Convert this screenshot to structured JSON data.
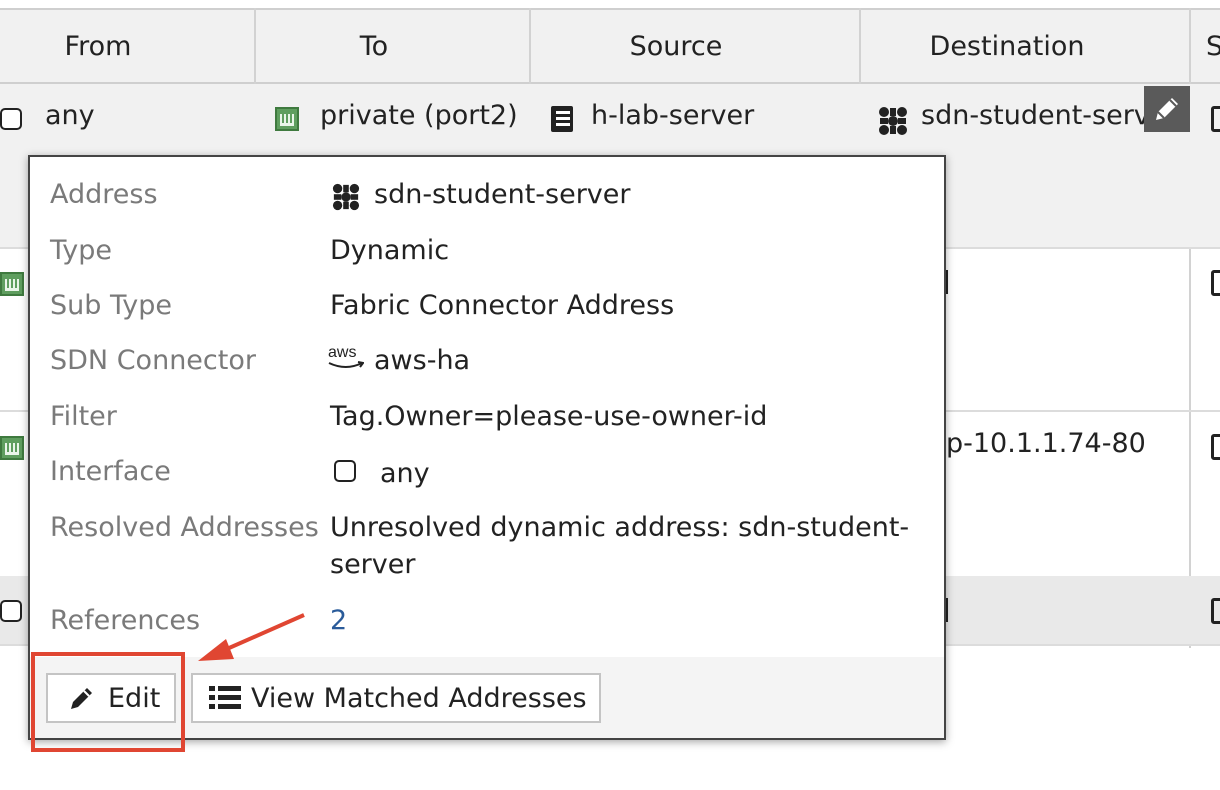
{
  "table": {
    "headers": [
      "From",
      "To",
      "Source",
      "Destination",
      "S"
    ],
    "row1": {
      "from": "any",
      "to": "private (port2)",
      "source": "h-lab-server",
      "destination": "sdn-student-serv"
    },
    "row3_destination": "p-10.1.1.74-80"
  },
  "popup": {
    "rows": [
      {
        "label": "Address",
        "value": "sdn-student-server",
        "icon": "fabric-address-icon"
      },
      {
        "label": "Type",
        "value": "Dynamic"
      },
      {
        "label": "Sub Type",
        "value": "Fabric Connector Address"
      },
      {
        "label": "SDN Connector",
        "value": "aws-ha",
        "icon": "aws-icon",
        "icon_text": "aws"
      },
      {
        "label": "Filter",
        "value": "Tag.Owner=please-use-owner-id"
      },
      {
        "label": "Interface",
        "value": "any",
        "icon": "interface-any-icon"
      },
      {
        "label": "Resolved Addresses",
        "value_line1": "Unresolved dynamic address: sdn-student-",
        "value_line2": "server"
      },
      {
        "label": "References",
        "value": "2"
      }
    ],
    "buttons": {
      "edit": "Edit",
      "view_matched": "View Matched Addresses"
    }
  },
  "colors": {
    "annotation": "#e04632",
    "link": "#2a5b9a",
    "label": "#7a7a7a"
  }
}
